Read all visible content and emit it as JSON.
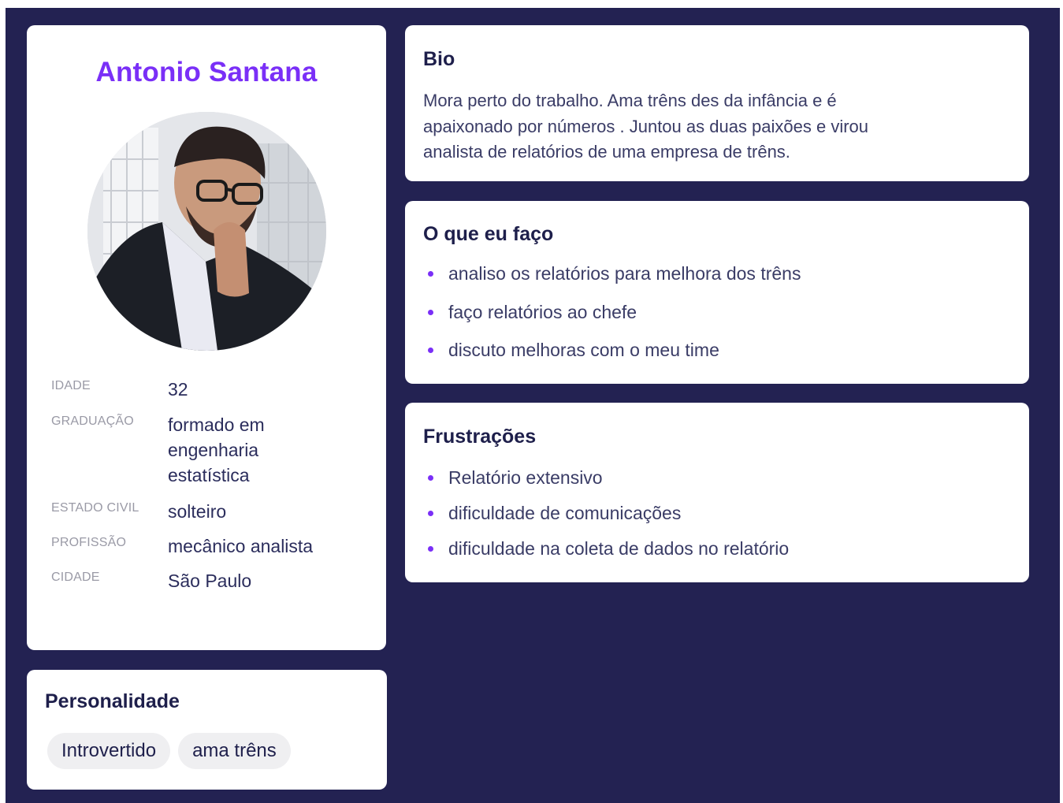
{
  "profile": {
    "name": "Antonio Santana",
    "facts": [
      {
        "label": "IDADE",
        "value": "32"
      },
      {
        "label": "GRADUAÇÃO",
        "value": "formado em engenharia estatística"
      },
      {
        "label": "ESTADO CIVIL",
        "value": "solteiro"
      },
      {
        "label": "PROFISSÃO",
        "value": "mecânico analista"
      },
      {
        "label": "CIDADE",
        "value": "São Paulo"
      }
    ]
  },
  "personality": {
    "title": "Personalidade",
    "traits": [
      "Introvertido",
      "ama trêns"
    ]
  },
  "bio": {
    "title": "Bio",
    "text": "Mora perto do trabalho. Ama trêns des da infância e é apaixonado por números . Juntou as duas paixões e virou analista de relatórios de uma empresa de trêns."
  },
  "doing": {
    "title": "O que eu faço",
    "items": [
      "analiso os relatórios para melhora dos trêns",
      "faço relatórios ao chefe",
      "discuto melhoras com o meu time"
    ]
  },
  "frustrations": {
    "title": "Frustrações",
    "items": [
      "Relatório extensivo",
      "dificuldade de comunicações",
      "dificuldade na coleta de dados no relatório"
    ]
  },
  "colors": {
    "background": "#232252",
    "card": "#ffffff",
    "accent": "#7a2ff7",
    "heading": "#1e1f4b",
    "chip": "#efeff1"
  }
}
